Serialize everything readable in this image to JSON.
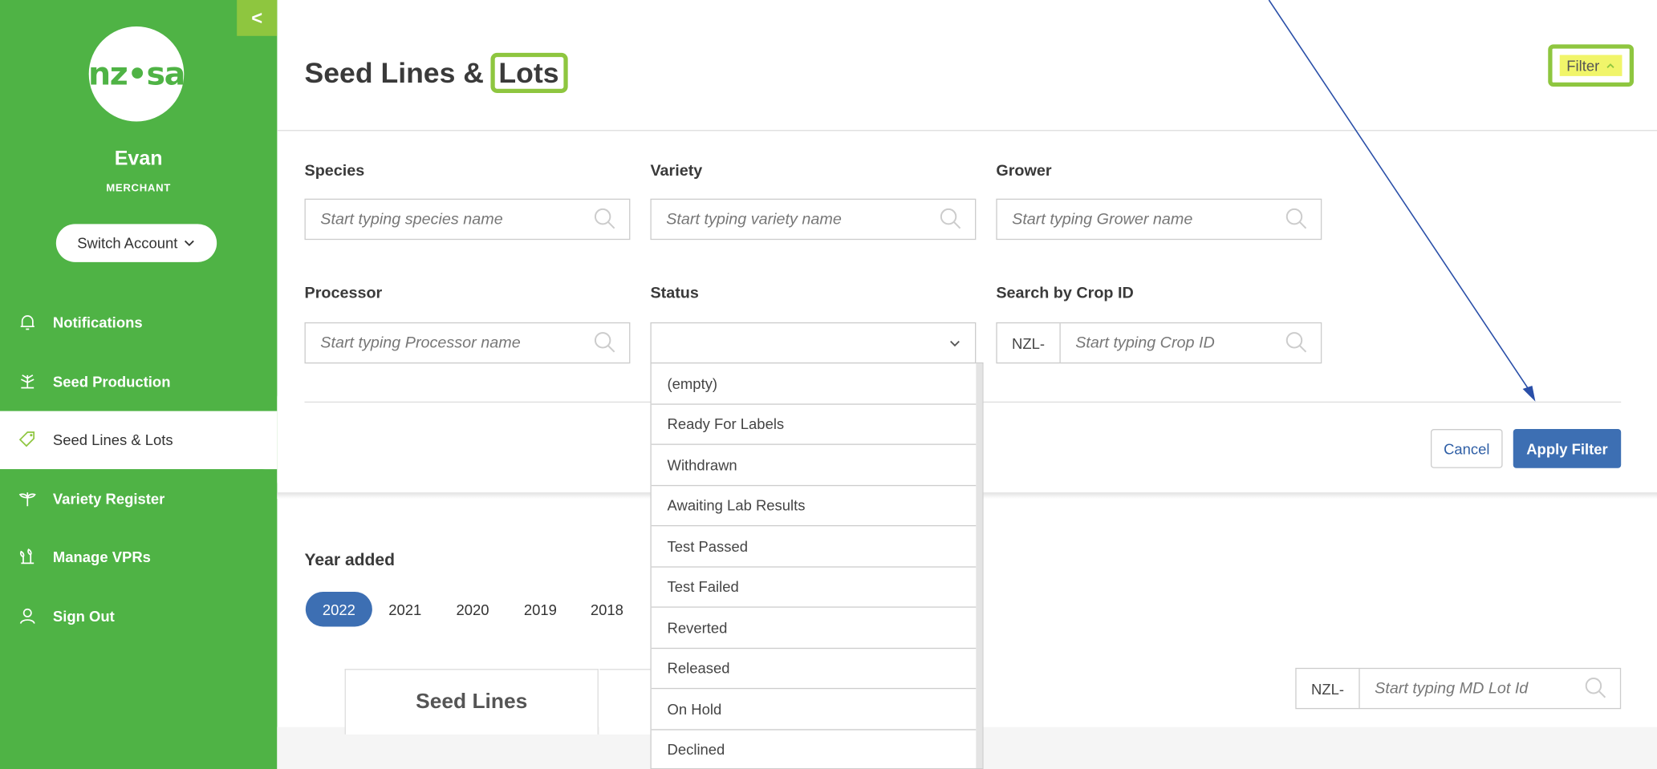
{
  "sidebar": {
    "collapse_label": "<",
    "logo_text": "nz•sa",
    "user_name": "Evan",
    "user_role": "MERCHANT",
    "switch_account": "Switch Account",
    "nav": [
      {
        "label": "Notifications",
        "icon": "bell-icon"
      },
      {
        "label": "Seed Production",
        "icon": "seed-production-icon"
      },
      {
        "label": "Seed Lines & Lots",
        "icon": "tag-icon",
        "active": true
      },
      {
        "label": "Variety Register",
        "icon": "sprout-icon"
      },
      {
        "label": "Manage VPRs",
        "icon": "plants-icon"
      },
      {
        "label": "Sign Out",
        "icon": "user-icon"
      }
    ]
  },
  "header": {
    "title_prefix": "Seed Lines &",
    "title_highlight": "Lots",
    "filter_toggle": "Filter"
  },
  "filters": {
    "species": {
      "label": "Species",
      "placeholder": "Start typing species name"
    },
    "variety": {
      "label": "Variety",
      "placeholder": "Start typing variety name"
    },
    "grower": {
      "label": "Grower",
      "placeholder": "Start typing Grower name"
    },
    "processor": {
      "label": "Processor",
      "placeholder": "Start typing Processor name"
    },
    "status": {
      "label": "Status",
      "value": ""
    },
    "crop_id": {
      "label": "Search by Crop ID",
      "prefix": "NZL-",
      "placeholder": "Start typing Crop ID"
    },
    "cancel_label": "Cancel",
    "apply_label": "Apply Filter"
  },
  "status_options": [
    "(empty)",
    "Ready For Labels",
    "Withdrawn",
    "Awaiting Lab Results",
    "Test Passed",
    "Test Failed",
    "Reverted",
    "Released",
    "On Hold",
    "Declined"
  ],
  "year_section": {
    "label": "Year added",
    "years": [
      "2022",
      "2021",
      "2020",
      "2019",
      "2018"
    ],
    "selected": "2022"
  },
  "tabs": {
    "seed_lines": "Seed Lines"
  },
  "lot_search": {
    "prefix": "NZL-",
    "placeholder": "Start typing MD Lot Id"
  },
  "colors": {
    "brand_green": "#4fb345",
    "highlight_green": "#8ec63f",
    "primary_blue": "#3d6fb3",
    "annotation_arrow": "#2a4fa8"
  }
}
